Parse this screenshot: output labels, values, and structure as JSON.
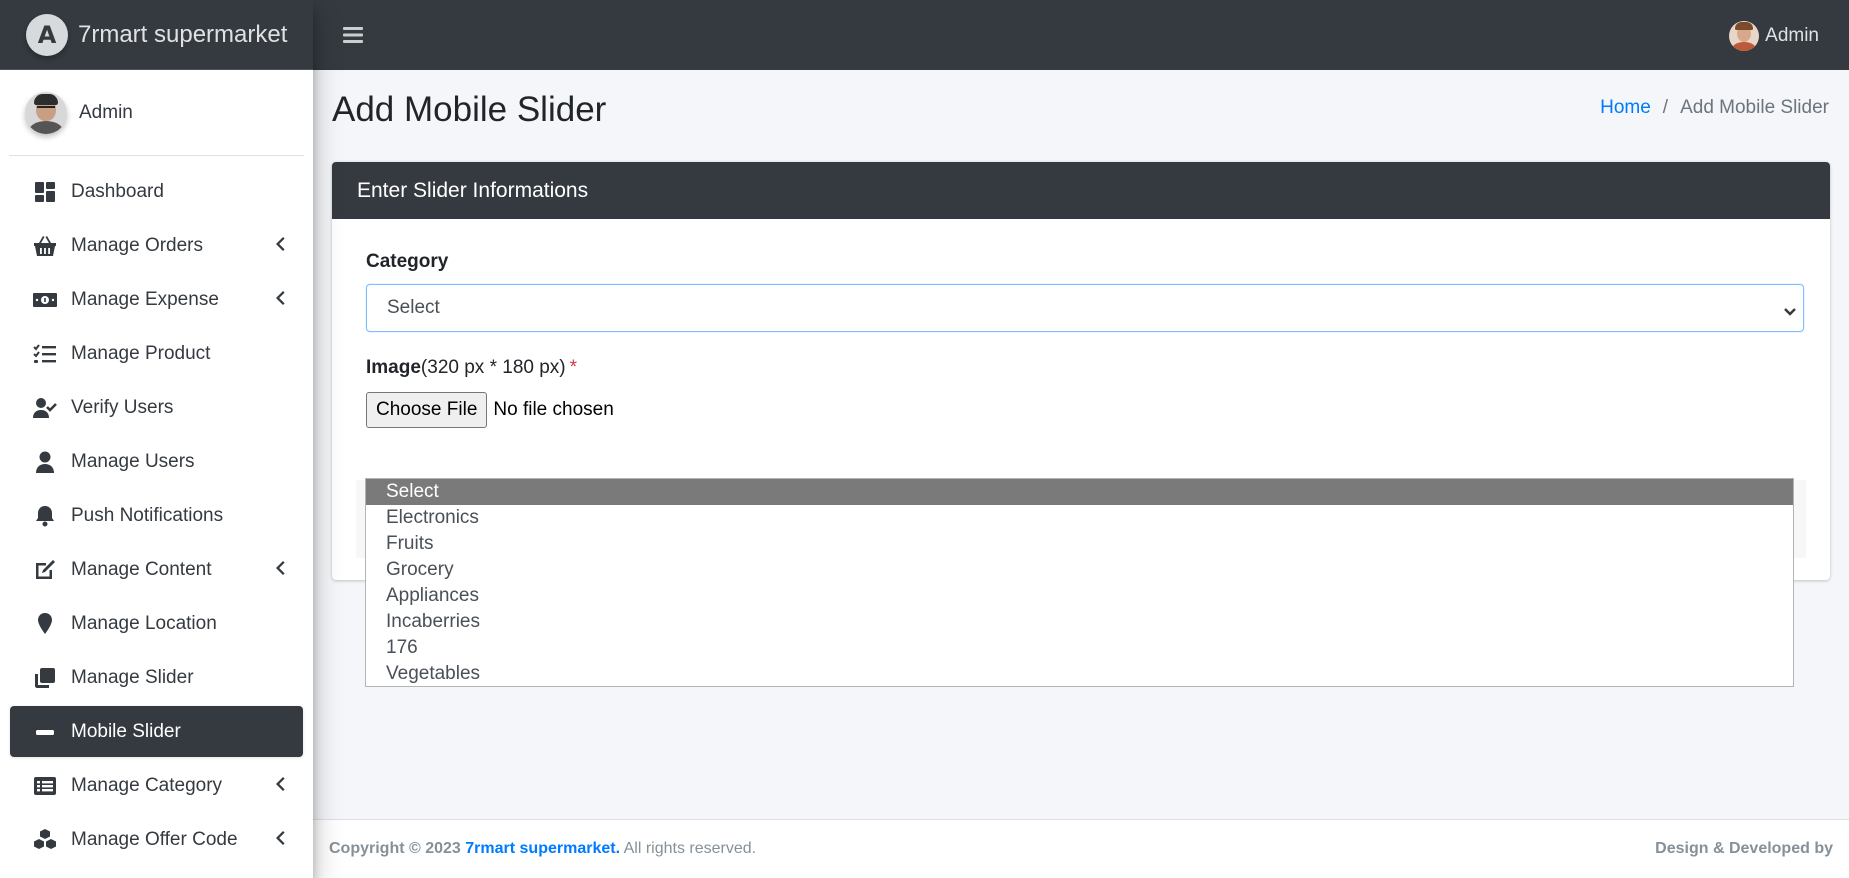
{
  "brand": {
    "logo_letter": "A",
    "name": "7rmart supermarket"
  },
  "sidebar": {
    "user_name": "Admin",
    "items": [
      {
        "label": "Dashboard",
        "icon": "dashboard-icon",
        "arrow": false,
        "active": false
      },
      {
        "label": "Manage Orders",
        "icon": "basket-icon",
        "arrow": true,
        "active": false
      },
      {
        "label": "Manage Expense",
        "icon": "money-bill-icon",
        "arrow": true,
        "active": false
      },
      {
        "label": "Manage Product",
        "icon": "tasks-list-icon",
        "arrow": false,
        "active": false
      },
      {
        "label": "Verify Users",
        "icon": "user-check-icon",
        "arrow": false,
        "active": false
      },
      {
        "label": "Manage Users",
        "icon": "user-icon",
        "arrow": false,
        "active": false
      },
      {
        "label": "Push Notifications",
        "icon": "bell-icon",
        "arrow": false,
        "active": false
      },
      {
        "label": "Manage Content",
        "icon": "edit-icon",
        "arrow": true,
        "active": false
      },
      {
        "label": "Manage Location",
        "icon": "map-marker-icon",
        "arrow": false,
        "active": false
      },
      {
        "label": "Manage Slider",
        "icon": "clone-icon",
        "arrow": false,
        "active": false
      },
      {
        "label": "Mobile Slider",
        "icon": "minus-bar-icon",
        "arrow": false,
        "active": true
      },
      {
        "label": "Manage Category",
        "icon": "list-alt-icon",
        "arrow": true,
        "active": false
      },
      {
        "label": "Manage Offer Code",
        "icon": "cubes-icon",
        "arrow": true,
        "active": false
      }
    ]
  },
  "topbar": {
    "user_name": "Admin"
  },
  "page": {
    "title": "Add Mobile Slider",
    "breadcrumb": {
      "home": "Home",
      "separator": "/",
      "current": "Add Mobile Slider"
    }
  },
  "form": {
    "card_title": "Enter Slider Informations",
    "category_label": "Category",
    "category_selected": "Select",
    "image_label": "Image",
    "image_hint": "(320 px * 180 px)",
    "required_mark": "*",
    "file_button": "Choose File",
    "file_status": "No file chosen"
  },
  "dropdown": {
    "options": [
      "Select",
      "Electronics",
      "Fruits",
      "Grocery",
      "Appliances",
      "Incaberries",
      "176",
      "Vegetables"
    ],
    "selected_index": 0
  },
  "footer": {
    "copyright": "Copyright © 2023",
    "brand": "7rmart supermarket.",
    "rights": "All rights reserved.",
    "right_text": "Design & Developed by"
  },
  "colors": {
    "dark": "#343a40",
    "accent": "#007bff",
    "background": "#f4f6f9",
    "required": "#dc3545"
  }
}
